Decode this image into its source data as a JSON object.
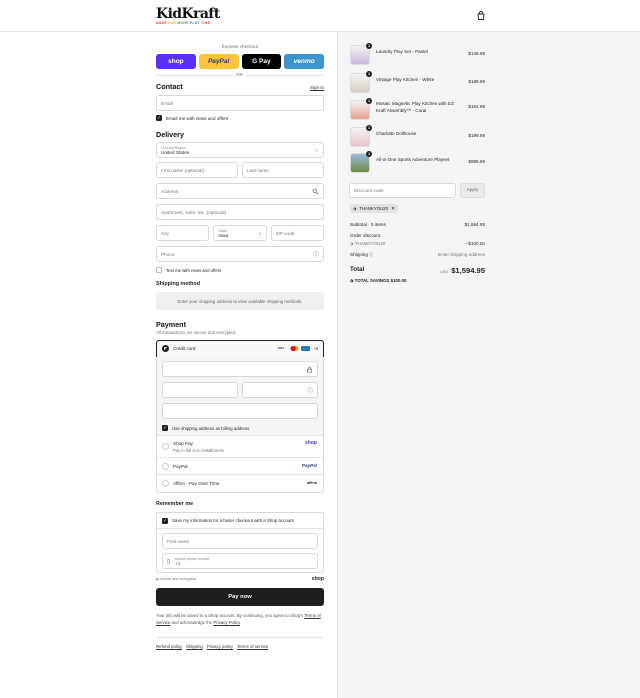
{
  "brand": {
    "name": "KidKraft",
    "tagline": [
      "MADE ",
      "FOR ",
      "MORE ",
      "PLAY ",
      "TIME"
    ],
    "tagline_colors": [
      "#e8422a",
      "#f2a21d",
      "#3a9c47",
      "#2d7fd0",
      "#e8422a"
    ]
  },
  "express": {
    "title": "Express checkout",
    "or": "OR",
    "buttons": [
      {
        "label": "shop",
        "bg": "#5a31f4",
        "color": "#ffffff"
      },
      {
        "label": "PayPal",
        "bg": "#ffc439",
        "color": "#253b80"
      },
      {
        "label": "G Pay",
        "bg": "#000000",
        "color": "#ffffff"
      },
      {
        "label": "venmo",
        "bg": "#3d95ce",
        "color": "#ffffff"
      }
    ]
  },
  "contact": {
    "title": "Contact",
    "signin": "Sign in",
    "email_placeholder": "Email",
    "news": "Email me with news and offers"
  },
  "delivery": {
    "title": "Delivery",
    "country_label": "Country/Region",
    "country": "United States",
    "first": "First name (optional)",
    "last": "Last name",
    "address": "Address",
    "apt": "Apartment, suite, etc. (optional)",
    "city": "City",
    "state_label": "State",
    "state": "Iowa",
    "zip": "ZIP code",
    "phone": "Phone",
    "text_me": "Text me with news and offers"
  },
  "shipping": {
    "title": "Shipping method",
    "note": "Enter your shipping address to view available shipping methods."
  },
  "payment": {
    "title": "Payment",
    "sub": "All transactions are secure and encrypted.",
    "credit": "Credit card",
    "more_cards": "+5",
    "billing": "Use shipping address as billing address",
    "shoppay": "Shop Pay",
    "shoppay_sub": "Pay in full or in installments",
    "shoppay_logo": "shop",
    "paypal": "PayPal",
    "paypal_logo": "PayPal",
    "affirm": "Affirm - Pay Over Time",
    "affirm_logo": "affirm"
  },
  "remember": {
    "title": "Remember me",
    "save": "Save my information for a faster checkout with a Shop account",
    "first": "First name",
    "phone_label": "Mobile phone number",
    "phone": "+1"
  },
  "secure": {
    "text": "Secure and encrypted",
    "logo": "shop"
  },
  "pay_btn": "Pay now",
  "terms": {
    "pre": "Your info will be saved to a Shop account. By continuing, you agree to Shop's ",
    "tos": "Terms of Service",
    "mid": " and acknowledge the ",
    "privacy": "Privacy Policy",
    "end": "."
  },
  "footer": [
    "Refund policy",
    "Shipping",
    "Privacy policy",
    "Terms of service"
  ],
  "items": [
    {
      "name": "Laundry Play Set - Pastel",
      "price": "$139.99",
      "qty": "1",
      "color": "#c8b7d8"
    },
    {
      "name": "Vintage Play Kitchen - White",
      "price": "$189.99",
      "qty": "1",
      "color": "#d9cfc4"
    },
    {
      "name": "Mosaic Magnetic Play Kitchen with EZ Kraft Assembly™ - Coral",
      "price": "$164.99",
      "qty": "1",
      "color": "#e4a08f"
    },
    {
      "name": "Charlotte Dollhouse",
      "price": "$199.99",
      "qty": "1",
      "color": "#e7c4c8"
    },
    {
      "name": "All-in-One Sports Adventure Playset",
      "price": "$999.99",
      "qty": "1",
      "color": "#6f8a45"
    }
  ],
  "discount": {
    "placeholder": "Discount code",
    "apply": "Apply",
    "code": "THANKYOU20"
  },
  "summary": {
    "subtotal_label": "Subtotal · 5 items",
    "subtotal": "$1,694.95",
    "order_discount": "Order discount",
    "code": "THANKYOU20",
    "discount": "−$100.00",
    "shipping_label": "Shipping",
    "shipping": "Enter shipping address",
    "total_label": "Total",
    "currency": "USD",
    "total": "$1,594.95",
    "savings_label": "TOTAL SAVINGS",
    "savings": "$100.00"
  }
}
